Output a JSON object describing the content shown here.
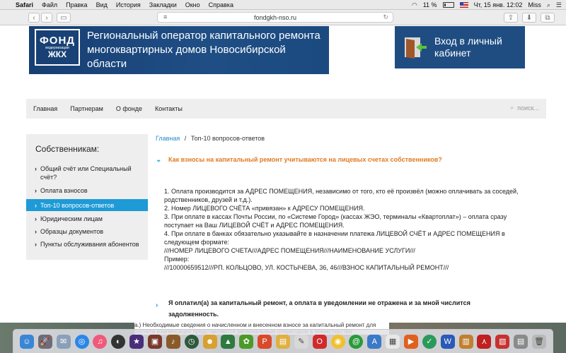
{
  "menubar": {
    "app": "Safari",
    "items": [
      "Файл",
      "Правка",
      "Вид",
      "История",
      "Закладки",
      "Окно",
      "Справка"
    ],
    "battery": "11 %",
    "clock": "Чт, 15 янв.  12:02",
    "user": "Miss"
  },
  "browser": {
    "url": "fondgkh-nso.ru"
  },
  "header": {
    "logo_line1": "ФОНД",
    "logo_line2": "модернизации",
    "logo_line3": "ЖКХ",
    "operator_title": "Региональный оператор капитального ремонта многоквартирных домов Новосибирской области",
    "login_label": "Вход в личный кабинет"
  },
  "nav": {
    "items": [
      "Главная",
      "Партнерам",
      "О фонде",
      "Контакты"
    ],
    "search_placeholder": "поиск..."
  },
  "sidebar": {
    "title": "Собственникам:",
    "items": [
      {
        "label": "Общий счёт или Специальный счёт?"
      },
      {
        "label": "Оплата взносов"
      },
      {
        "label": "Топ-10 вопросов-ответов"
      },
      {
        "label": "Юридическим лицам"
      },
      {
        "label": "Образцы документов"
      },
      {
        "label": "Пункты обслуживания абонентов"
      }
    ],
    "active_index": 2
  },
  "breadcrumb": {
    "home": "Главная",
    "separator": "/",
    "current": "Топ-10 вопросов-ответов"
  },
  "faq": {
    "q1": "Как взносы на капитальный ремонт учитываются на лицевых счетах собственников?",
    "answer_lines": [
      "1. Оплата производится за АДРЕС ПОМЕЩЕНИЯ, независимо от того, кто её произвёл (можно оплачивать за соседей, родственников, друзей и т.д.).",
      "2. Номер ЛИЦЕВОГО СЧЁТА «привязан» к АДРЕСУ ПОМЕЩЕНИЯ.",
      "3. При оплате в кассах Почты России, по «Системе Город» (кассах ЖЭО, терминалы «Квартоплат») – оплата сразу поступает на Ваш ЛИЦЕВОЙ СЧЁТ и АДРЕС ПОМЕЩЕНИЯ.",
      "4. При оплате в банках обязательно указывайте в назначении платежа ЛИЦЕВОЙ СЧЁТ и АДРЕС ПОМЕЩЕНИЯ в следующем формате:",
      "///НОМЕР ЛИЦЕВОГО СЧЕТА///АДРЕС ПОМЕЩЕНИЯ///НАИМЕНОВАНИЕ УСЛУГИ///",
      "Пример:",
      "///10000659512///РП. КОЛЬЦОВО, УЛ. КОСТЫЧЕВА, 36, 46///ВЗНОС КАПИТАЛЬНЫЙ РЕМОНТ///"
    ],
    "q2": "Я оплатил(а) за капитальный ремонт, а оплата в уведомлении не отражена и за мной числится задолженность."
  },
  "behind_text": "а.) Необходимые сведения о начисленном и внесенном взносе за капитальный ремонт для расчета компенсации представляются региональным оператором в Министерство"
}
